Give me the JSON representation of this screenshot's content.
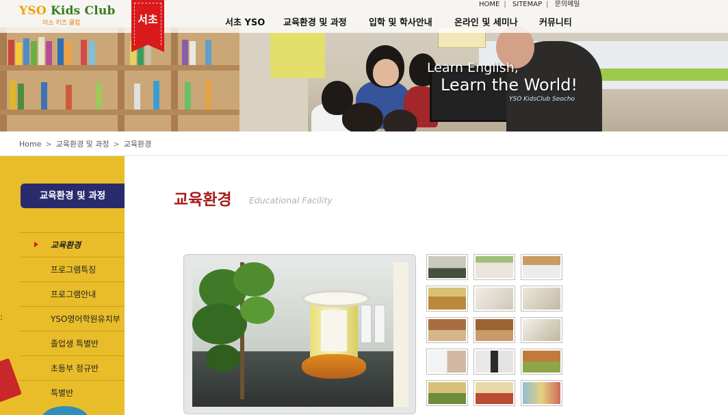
{
  "header": {
    "logo_brand": "YSO",
    "logo_name": "Kids Club",
    "logo_subtitle": "이소 키즈 클럽",
    "branch_tag": "서초",
    "util_links": [
      "HOME",
      "SITEMAP",
      "문의메일"
    ],
    "nav": [
      "서초 YSO",
      "교육환경 및 과정",
      "입학 및 학사안내",
      "온라인 및 세미나",
      "커뮤니티"
    ]
  },
  "hero": {
    "slogan_line1": "Learn English,",
    "slogan_line2": "Learn the World!",
    "slogan_tagline": "YSO KidsClub Seocho"
  },
  "breadcrumb": [
    "Home",
    "교육환경 및 과정",
    "교육환경"
  ],
  "sidebar": {
    "title": "교육환경 및 과정",
    "items": [
      {
        "label": "교육환경",
        "active": true
      },
      {
        "label": "프로그램특징",
        "active": false
      },
      {
        "label": "프로그램안내",
        "active": false
      },
      {
        "label": "YSO영어학원유치부",
        "active": false
      },
      {
        "label": "졸업생 특별반",
        "active": false
      },
      {
        "label": "초등부 정규반",
        "active": false
      },
      {
        "label": "특별반",
        "active": false
      }
    ]
  },
  "main": {
    "heading": "교육환경",
    "heading_en": "Educational Facility",
    "thumbnail_count": 15
  },
  "colors": {
    "accent_red": "#a51c1c",
    "branch_red": "#d9191c",
    "sidebar_yellow": "#e9bd29",
    "sidebar_title_navy": "#2a2b6d",
    "logo_green": "#3a7a1e",
    "logo_orange": "#f0a300"
  }
}
